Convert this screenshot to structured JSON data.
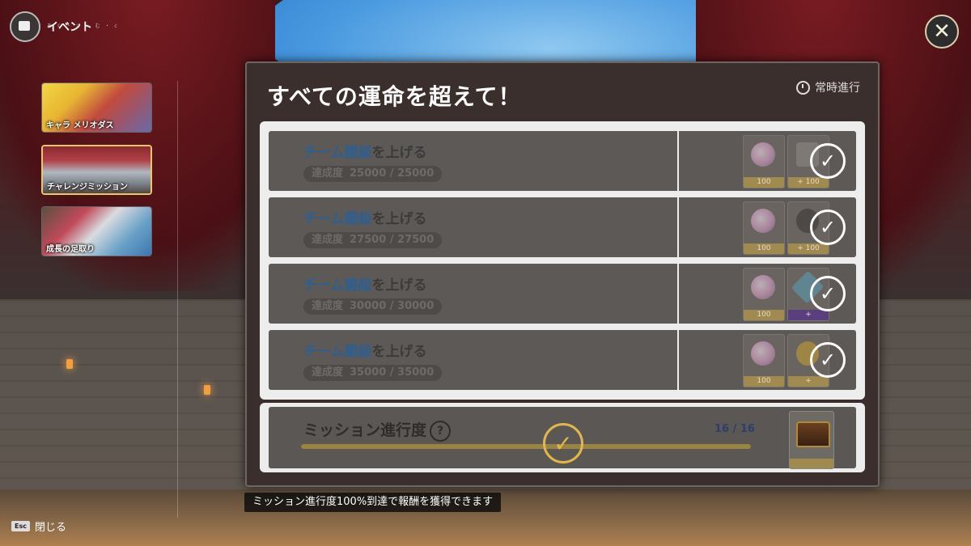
{
  "header": {
    "title": "イベント",
    "subtitle": "あ く ・ さ ・ む ・ c"
  },
  "sidebar": {
    "tabs": [
      {
        "label": "キャラ メリオダス",
        "active": false
      },
      {
        "label": "チャレンジミッション",
        "active": true
      },
      {
        "label": "成長の足取り",
        "active": false
      }
    ]
  },
  "panel": {
    "title": "すべての運命を超えて！",
    "badge": "常時進行",
    "rows": [
      {
        "name_highlight": "チーム闘級",
        "name_rest": "を上げる",
        "progress_label": "達成度",
        "progress_value": "25000 / 25000",
        "reward1_qty": "100",
        "reward2_qty": "+ 100",
        "completed": true
      },
      {
        "name_highlight": "チーム闘級",
        "name_rest": "を上げる",
        "progress_label": "達成度",
        "progress_value": "27500 / 27500",
        "reward1_qty": "100",
        "reward2_qty": "+ 100",
        "completed": true
      },
      {
        "name_highlight": "チーム闘級",
        "name_rest": "を上げる",
        "progress_label": "達成度",
        "progress_value": "30000 / 30000",
        "reward1_qty": "100",
        "reward2_qty": "+",
        "completed": true
      },
      {
        "name_highlight": "チーム闘級",
        "name_rest": "を上げる",
        "progress_label": "達成度",
        "progress_value": "35000 / 35000",
        "reward1_qty": "100",
        "reward2_qty": "+",
        "completed": true
      }
    ],
    "mission": {
      "title": "ミッション進行度",
      "help": "?",
      "count": "16 / 16",
      "fraction": 1.0
    }
  },
  "footer": {
    "hint": "ミッション進行度100%到達で報酬を獲得できます",
    "esc_key": "Esc",
    "esc_label": "閉じる"
  },
  "icons": {
    "close": "close-icon",
    "check": "check-icon",
    "clock": "clock-icon"
  },
  "colors": {
    "accent_gold": "#e2b74a",
    "highlight_blue": "#2f5f90",
    "active_tab_border": "#e9c76a"
  }
}
